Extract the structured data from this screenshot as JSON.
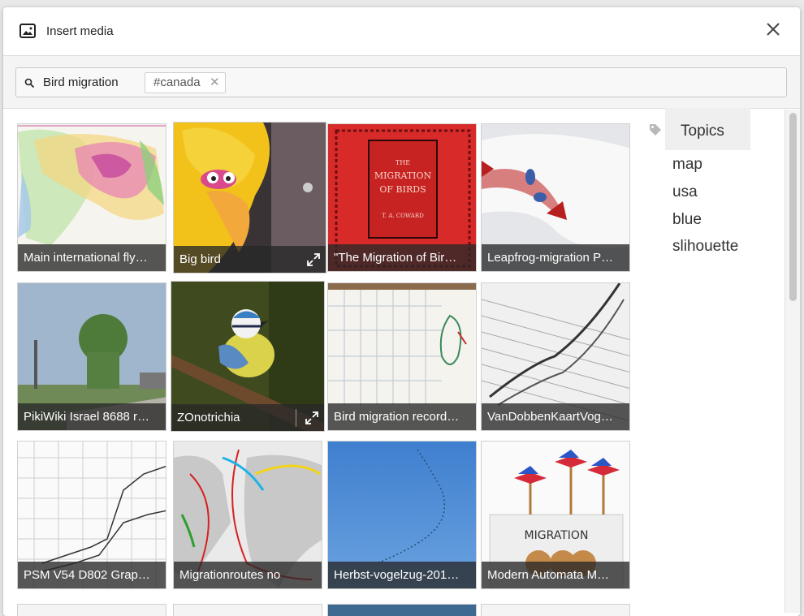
{
  "dialog": {
    "title": "Insert media"
  },
  "search": {
    "query": "Bird migration",
    "tag": "#canada",
    "tag_remove": "✕"
  },
  "topics": {
    "heading": "Topics",
    "items": [
      "map",
      "usa",
      "blue",
      "slihouette"
    ]
  },
  "tiles": [
    {
      "caption": "Main international fly…"
    },
    {
      "caption": "Big bird"
    },
    {
      "caption": "\"The Migration of Bir…"
    },
    {
      "caption": "Leapfrog-migration P…"
    },
    {
      "caption": "PikiWiki Israel 8688 r…"
    },
    {
      "caption": "ZOnotrichia"
    },
    {
      "caption": "Bird migration record…"
    },
    {
      "caption": "VanDobbenKaartVog…"
    },
    {
      "caption": "PSM V54 D802 Grap…"
    },
    {
      "caption": "Migrationroutes no"
    },
    {
      "caption": "Herbst-vogelzug-201…"
    },
    {
      "caption": "Modern Automata M…"
    }
  ],
  "book_cover": {
    "line1": "THE",
    "line2": "MIGRATION",
    "line3": "OF BIRDS",
    "author": "T. A. COWARD"
  },
  "sign_text": "MIGRATION",
  "colors": {
    "accent": "#c8221b",
    "caption_bg": "#282828"
  }
}
